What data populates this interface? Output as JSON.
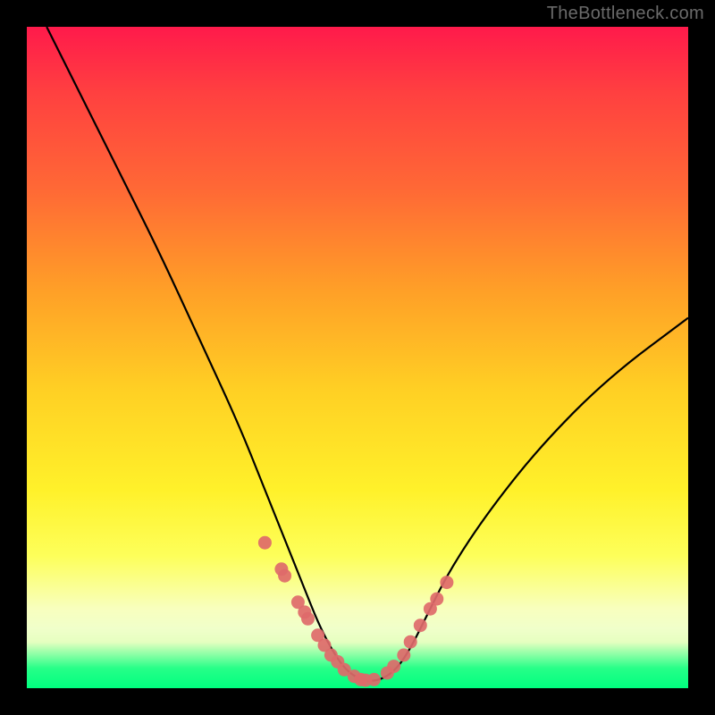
{
  "attribution": "TheBottleneck.com",
  "chart_data": {
    "type": "line",
    "title": "",
    "xlabel": "",
    "ylabel": "",
    "xlim": [
      0,
      100
    ],
    "ylim": [
      0,
      100
    ],
    "series": [
      {
        "name": "bottleneck-curve",
        "color": "#000000",
        "x": [
          3,
          8,
          14,
          20,
          26,
          32,
          36,
          40,
          42,
          44,
          46,
          48,
          50,
          52,
          54,
          56,
          58,
          60,
          64,
          70,
          78,
          88,
          100
        ],
        "y": [
          100,
          90,
          78,
          66,
          53,
          40,
          30,
          20,
          15,
          10,
          6,
          3,
          1.5,
          1,
          1.5,
          3,
          6,
          10,
          18,
          27,
          37,
          47,
          56
        ]
      },
      {
        "name": "highlight-dots",
        "color": "#de6a6a",
        "type": "scatter",
        "x": [
          36,
          38.5,
          39,
          41,
          42,
          42.5,
          44,
          45,
          46,
          47,
          48,
          49.5,
          50.5,
          51.2,
          52.5,
          54.5,
          55.5,
          57,
          58,
          59.5,
          61,
          62,
          63.5
        ],
        "y": [
          22,
          18,
          17,
          13,
          11.5,
          10.5,
          8,
          6.5,
          5,
          4,
          2.8,
          1.8,
          1.3,
          1.2,
          1.3,
          2.3,
          3.3,
          5,
          7,
          9.5,
          12,
          13.5,
          16
        ]
      }
    ]
  }
}
